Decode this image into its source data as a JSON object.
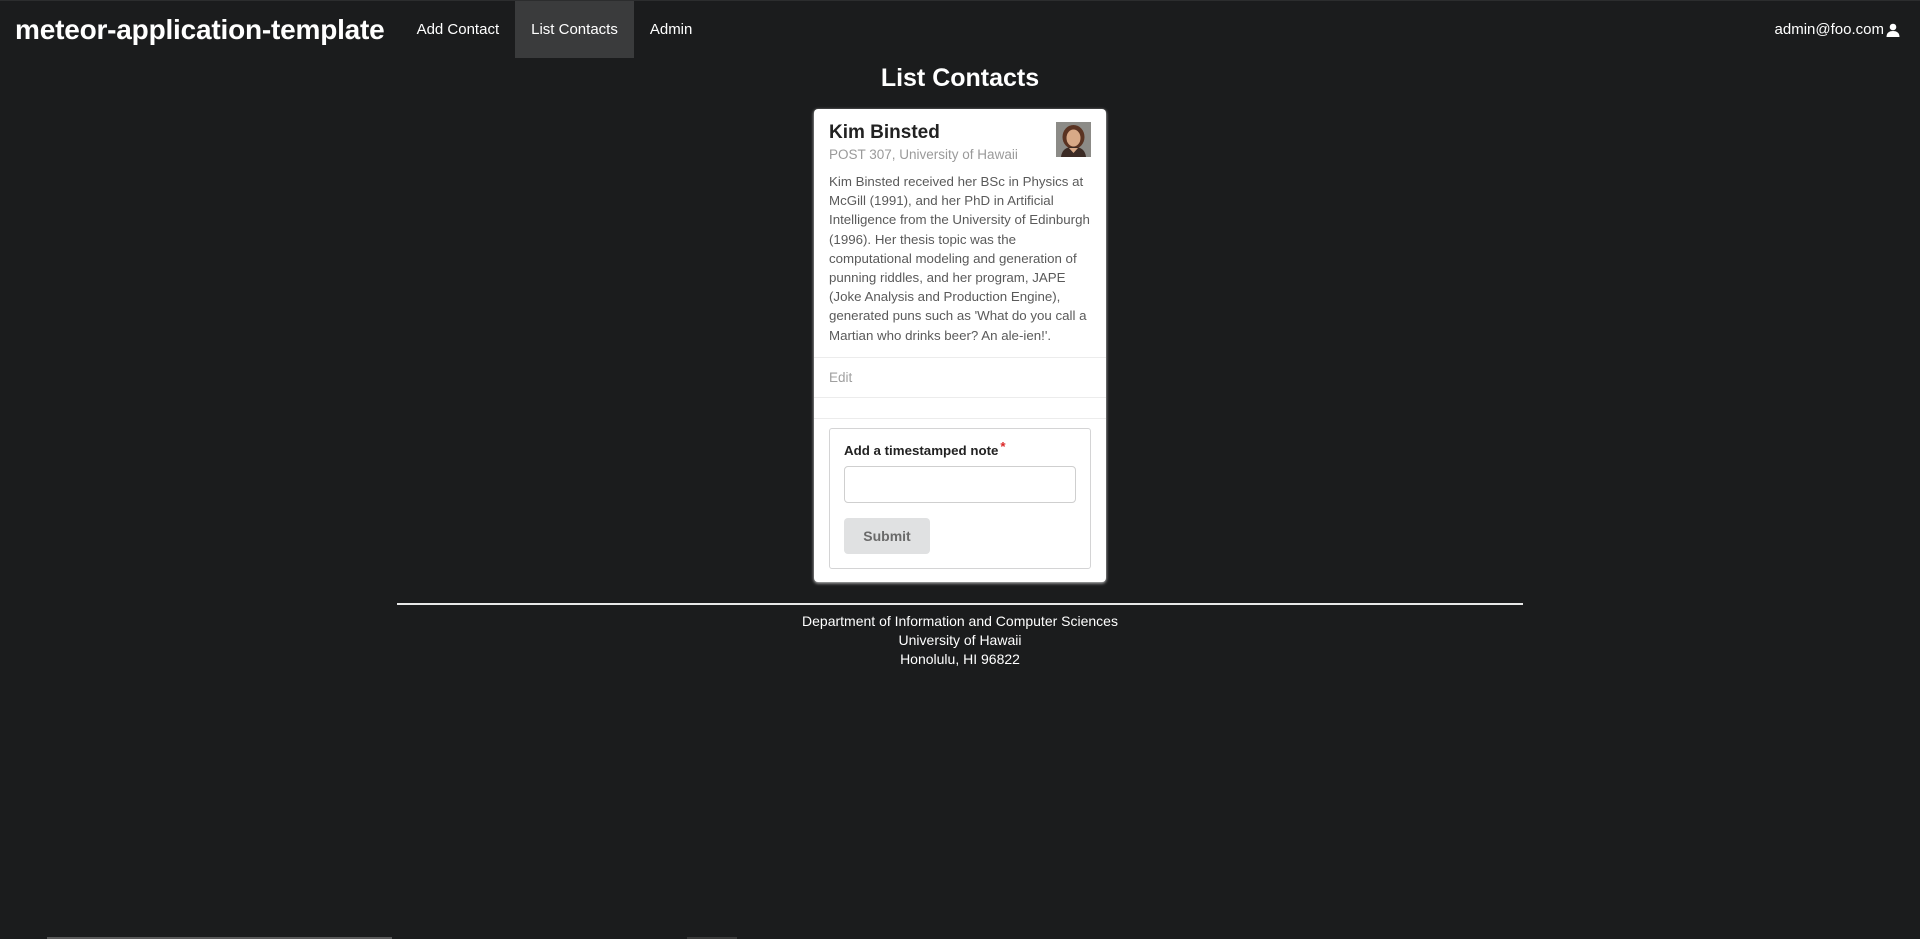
{
  "navbar": {
    "brand": "meteor-application-template",
    "items": [
      {
        "label": "Add Contact",
        "active": false
      },
      {
        "label": "List Contacts",
        "active": true
      },
      {
        "label": "Admin",
        "active": false
      }
    ],
    "user_email": "admin@foo.com",
    "user_icon": "user-icon"
  },
  "page": {
    "title": "List Contacts"
  },
  "contact": {
    "name": "Kim Binsted",
    "address": "POST 307, University of Hawaii",
    "avatar_icon": "contact-photo",
    "description": "Kim Binsted received her BSc in Physics at McGill (1991), and her PhD in Artificial Intelligence from the University of Edinburgh (1996). Her thesis topic was the computational modeling and generation of punning riddles, and her program, JAPE (Joke Analysis and Production Engine), generated puns such as 'What do you call a Martian who drinks beer? An ale-ien!'.",
    "edit_label": "Edit"
  },
  "note_form": {
    "label": "Add a timestamped note",
    "required_mark": "*",
    "value": "",
    "placeholder": "",
    "submit_label": "Submit"
  },
  "footer": {
    "line1": "Department of Information and Computer Sciences",
    "line2": "University of Hawaii",
    "line3": "Honolulu, HI 96822"
  },
  "colors": {
    "background": "#1b1c1d",
    "active_nav": "#3a3b3c",
    "required": "#db2828"
  }
}
